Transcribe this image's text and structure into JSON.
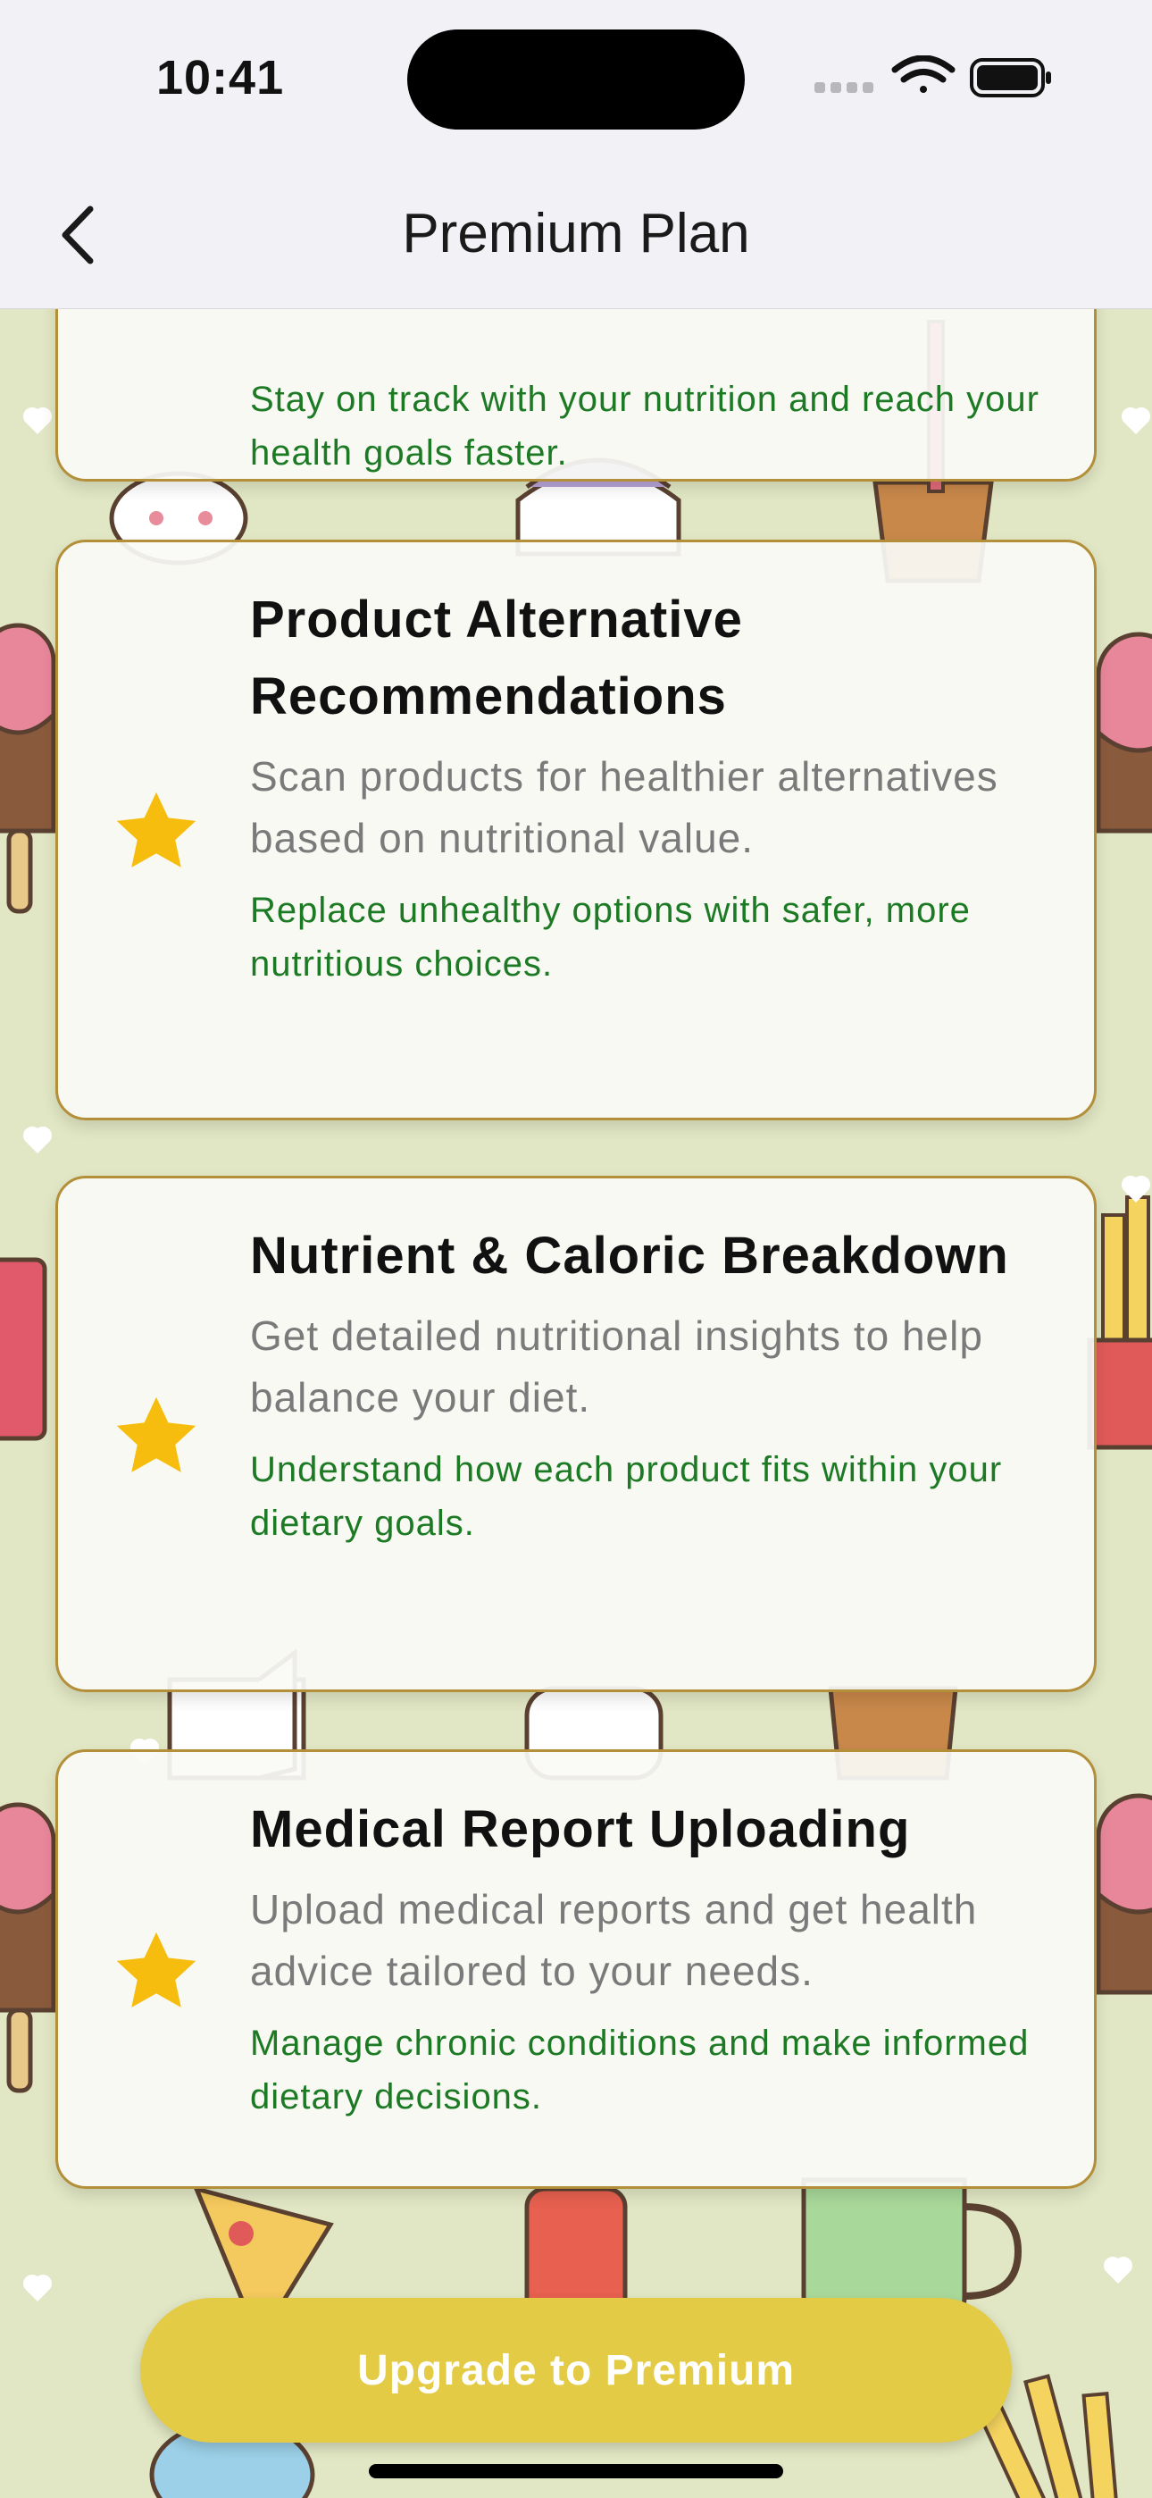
{
  "status_bar": {
    "time": "10:41"
  },
  "nav": {
    "title": "Premium Plan",
    "back_icon": "chevron-left-icon"
  },
  "features": [
    {
      "title": "",
      "description": "",
      "benefit": "Stay on track with your nutrition and reach your health goals faster.",
      "icon": "star-icon"
    },
    {
      "title": "Product Alternative Recommendations",
      "description": "Scan products for healthier alternatives based on nutritional value.",
      "benefit": "Replace unhealthy options with safer, more nutritious choices.",
      "icon": "star-icon"
    },
    {
      "title": "Nutrient & Caloric Breakdown",
      "description": "Get detailed nutritional insights to help balance your diet.",
      "benefit": "Understand how each product fits within your dietary goals.",
      "icon": "star-icon"
    },
    {
      "title": "Medical Report Uploading",
      "description": "Upload medical reports and get health advice tailored to your needs.",
      "benefit": "Manage chronic conditions and make informed dietary decisions.",
      "icon": "star-icon"
    }
  ],
  "cta": {
    "label": "Upgrade to Premium"
  },
  "colors": {
    "accent": "#e3cb45",
    "star": "#f7bd0e",
    "benefit_text": "#1d7a24",
    "card_border": "#b48f3a",
    "background": "#e1e7c4"
  }
}
